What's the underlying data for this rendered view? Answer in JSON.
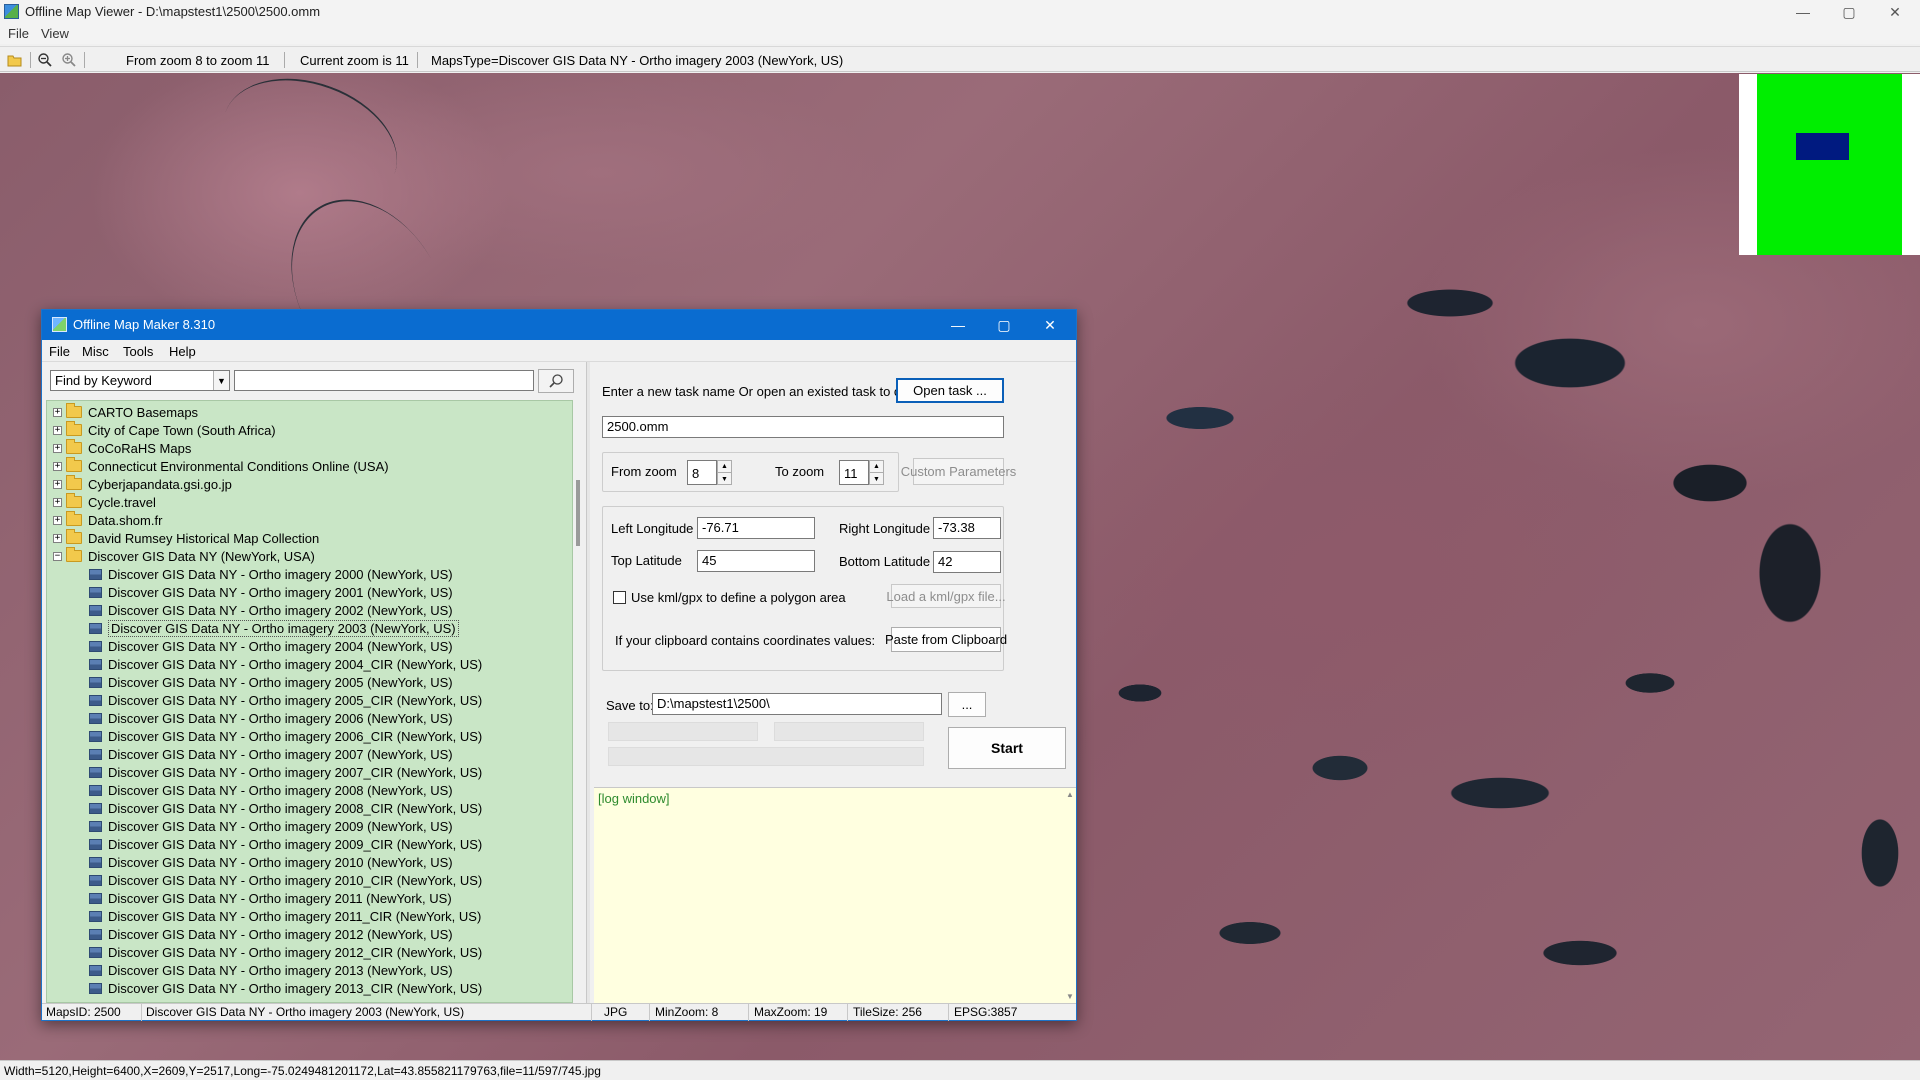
{
  "app": {
    "title": "Offline Map Viewer - D:\\mapstest1\\2500\\2500.omm",
    "menu": [
      "File",
      "View"
    ],
    "toolbar": {
      "zoom_range": "From zoom 8 to zoom 11",
      "current_zoom": "Current zoom is 11",
      "maps_type": "MapsType=Discover GIS Data NY - Ortho imagery 2003 (NewYork, US)"
    },
    "status": "Width=5120,Height=6400,X=2609,Y=2517,Long=-75.0249481201172,Lat=43.855821179763,file=11/597/745.jpg",
    "window_controls": {
      "minimize": "—",
      "maximize": "▢",
      "close": "✕"
    }
  },
  "dialog": {
    "title": "Offline Map Maker 8.310",
    "menu": [
      "File",
      "Misc",
      "Tools",
      "Help"
    ],
    "search": {
      "mode": "Find by Keyword",
      "keyword": ""
    },
    "tree": [
      {
        "label": "CARTO Basemaps",
        "type": "folder",
        "expanded": false
      },
      {
        "label": "City of Cape Town (South Africa)",
        "type": "folder",
        "expanded": false
      },
      {
        "label": "CoCoRaHS Maps",
        "type": "folder",
        "expanded": false
      },
      {
        "label": "Connecticut Environmental Conditions Online (USA)",
        "type": "folder",
        "expanded": false
      },
      {
        "label": "Cyberjapandata.gsi.go.jp",
        "type": "folder",
        "expanded": false
      },
      {
        "label": "Cycle.travel",
        "type": "folder",
        "expanded": false
      },
      {
        "label": "Data.shom.fr",
        "type": "folder",
        "expanded": false
      },
      {
        "label": "David Rumsey Historical Map Collection",
        "type": "folder",
        "expanded": false
      },
      {
        "label": "Discover GIS Data NY (NewYork, USA)",
        "type": "folder",
        "expanded": true
      },
      {
        "label": "Discover GIS Data NY - Ortho imagery 2000 (NewYork, US)",
        "type": "map"
      },
      {
        "label": "Discover GIS Data NY - Ortho imagery 2001 (NewYork, US)",
        "type": "map"
      },
      {
        "label": "Discover GIS Data NY - Ortho imagery 2002 (NewYork, US)",
        "type": "map"
      },
      {
        "label": "Discover GIS Data NY - Ortho imagery 2003 (NewYork, US)",
        "type": "map",
        "selected": true
      },
      {
        "label": "Discover GIS Data NY - Ortho imagery 2004 (NewYork, US)",
        "type": "map"
      },
      {
        "label": "Discover GIS Data NY - Ortho imagery 2004_CIR (NewYork, US)",
        "type": "map"
      },
      {
        "label": "Discover GIS Data NY - Ortho imagery 2005 (NewYork, US)",
        "type": "map"
      },
      {
        "label": "Discover GIS Data NY - Ortho imagery 2005_CIR (NewYork, US)",
        "type": "map"
      },
      {
        "label": "Discover GIS Data NY - Ortho imagery 2006 (NewYork, US)",
        "type": "map"
      },
      {
        "label": "Discover GIS Data NY - Ortho imagery 2006_CIR (NewYork, US)",
        "type": "map"
      },
      {
        "label": "Discover GIS Data NY - Ortho imagery 2007 (NewYork, US)",
        "type": "map"
      },
      {
        "label": "Discover GIS Data NY - Ortho imagery 2007_CIR (NewYork, US)",
        "type": "map"
      },
      {
        "label": "Discover GIS Data NY - Ortho imagery 2008 (NewYork, US)",
        "type": "map"
      },
      {
        "label": "Discover GIS Data NY - Ortho imagery 2008_CIR (NewYork, US)",
        "type": "map"
      },
      {
        "label": "Discover GIS Data NY - Ortho imagery 2009 (NewYork, US)",
        "type": "map"
      },
      {
        "label": "Discover GIS Data NY - Ortho imagery 2009_CIR (NewYork, US)",
        "type": "map"
      },
      {
        "label": "Discover GIS Data NY - Ortho imagery 2010 (NewYork, US)",
        "type": "map"
      },
      {
        "label": "Discover GIS Data NY - Ortho imagery 2010_CIR (NewYork, US)",
        "type": "map"
      },
      {
        "label": "Discover GIS Data NY - Ortho imagery 2011 (NewYork, US)",
        "type": "map"
      },
      {
        "label": "Discover GIS Data NY - Ortho imagery 2011_CIR (NewYork, US)",
        "type": "map"
      },
      {
        "label": "Discover GIS Data NY - Ortho imagery 2012 (NewYork, US)",
        "type": "map"
      },
      {
        "label": "Discover GIS Data NY - Ortho imagery 2012_CIR (NewYork, US)",
        "type": "map"
      },
      {
        "label": "Discover GIS Data NY - Ortho imagery 2013 (NewYork, US)",
        "type": "map"
      },
      {
        "label": "Discover GIS Data NY - Ortho imagery 2013_CIR (NewYork, US)",
        "type": "map"
      }
    ],
    "task": {
      "prompt": "Enter a new task name Or open an existed task to continue:",
      "open_label": "Open task ...",
      "name": "2500.omm"
    },
    "zoom": {
      "from_label": "From zoom",
      "from_value": "8",
      "to_label": "To zoom",
      "to_value": "11",
      "custom_label": "Custom Parameters"
    },
    "coords": {
      "left_label": "Left Longitude",
      "left_value": "-76.71",
      "right_label": "Right Longitude",
      "right_value": "-73.38",
      "top_label": "Top Latitude",
      "top_value": "45",
      "bottom_label": "Bottom Latitude",
      "bottom_value": "42"
    },
    "kml": {
      "label": "Use kml/gpx to define a polygon area",
      "checked": false,
      "load_label": "Load a kml/gpx file..."
    },
    "clipboard": {
      "prompt": "If your clipboard contains coordinates values:",
      "paste_label": "Paste from Clipboard"
    },
    "save": {
      "label": "Save to:",
      "path": "D:\\mapstest1\\2500\\",
      "browse_label": "..."
    },
    "start_label": "Start",
    "log_text": "[log window]",
    "status": {
      "maps_id": "MapsID: 2500",
      "map_name": "Discover GIS Data NY - Ortho imagery 2003 (NewYork, US)",
      "format": "JPG",
      "min_zoom": "MinZoom: 8",
      "max_zoom": "MaxZoom: 19",
      "tile_size": "TileSize: 256",
      "epsg": "EPSG:3857"
    }
  },
  "colors": {
    "dialog_title": "#0a6cd0",
    "tree_bg": "#c9e6c6",
    "log_bg": "#ffffe0",
    "overview_green": "#00ee00",
    "overview_rect": "#001a80"
  }
}
